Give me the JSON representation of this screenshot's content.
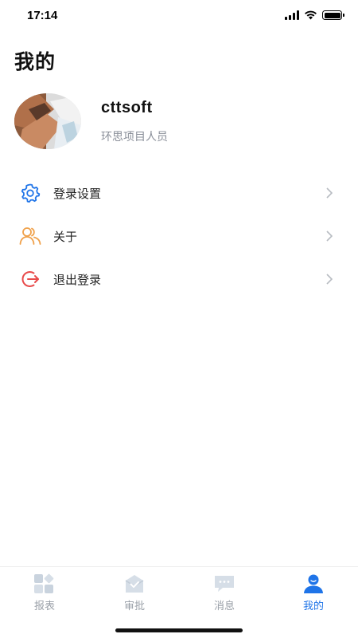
{
  "status_bar": {
    "time": "17:14"
  },
  "header": {
    "title": "我的"
  },
  "profile": {
    "username": "cttsoft",
    "role": "环思项目人员"
  },
  "menu": {
    "items": [
      {
        "label": "登录设置",
        "icon": "gear-icon",
        "color": "#1f74e8"
      },
      {
        "label": "关于",
        "icon": "users-icon",
        "color": "#f0a14a"
      },
      {
        "label": "退出登录",
        "icon": "logout-icon",
        "color": "#e84a4a"
      }
    ]
  },
  "tab_bar": {
    "tabs": [
      {
        "label": "报表",
        "icon": "report-icon",
        "active": false
      },
      {
        "label": "审批",
        "icon": "approval-icon",
        "active": false
      },
      {
        "label": "消息",
        "icon": "message-icon",
        "active": false
      },
      {
        "label": "我的",
        "icon": "profile-icon",
        "active": true
      }
    ]
  },
  "colors": {
    "accent": "#1f74e8",
    "inactive": "#9aa0a8"
  }
}
